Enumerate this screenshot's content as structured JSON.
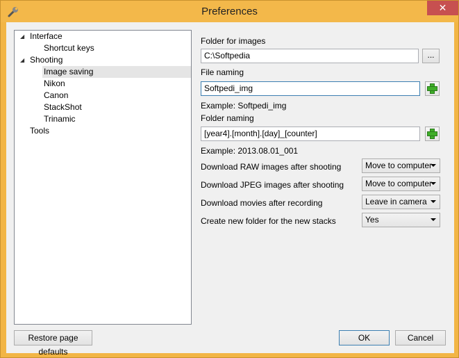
{
  "window": {
    "title": "Preferences",
    "close_label": "✕"
  },
  "tree": {
    "items": [
      {
        "label": "Interface",
        "level": 0,
        "expanded": true
      },
      {
        "label": "Shortcut keys",
        "level": 1
      },
      {
        "label": "Shooting",
        "level": 0,
        "expanded": true
      },
      {
        "label": "Image saving",
        "level": 1,
        "selected": true
      },
      {
        "label": "Nikon",
        "level": 1
      },
      {
        "label": "Canon",
        "level": 1
      },
      {
        "label": "StackShot",
        "level": 1
      },
      {
        "label": "Trinamic",
        "level": 1
      },
      {
        "label": "Tools",
        "level": 0
      }
    ]
  },
  "settings": {
    "folder_images_label": "Folder for images",
    "folder_images_value": "C:\\Softpedia",
    "browse_label": "...",
    "file_naming_label": "File naming",
    "file_naming_value": "Softpedi_img",
    "file_naming_example": "Example: Softpedi_img",
    "folder_naming_label": "Folder naming",
    "folder_naming_value": "[year4].[month].[day]_[counter]",
    "folder_naming_example": "Example: 2013.08.01_001",
    "raw_label": "Download RAW images after shooting",
    "raw_value": "Move to computer",
    "jpeg_label": "Download JPEG images after shooting",
    "jpeg_value": "Move to computer",
    "movies_label": "Download movies after recording",
    "movies_value": "Leave in camera",
    "stacks_label": "Create new folder for the new stacks",
    "stacks_value": "Yes"
  },
  "footer": {
    "restore_label": "Restore page defaults",
    "ok_label": "OK",
    "cancel_label": "Cancel"
  },
  "colors": {
    "frame": "#f2b545",
    "close": "#c75050",
    "plus_green": "#3fae29"
  }
}
